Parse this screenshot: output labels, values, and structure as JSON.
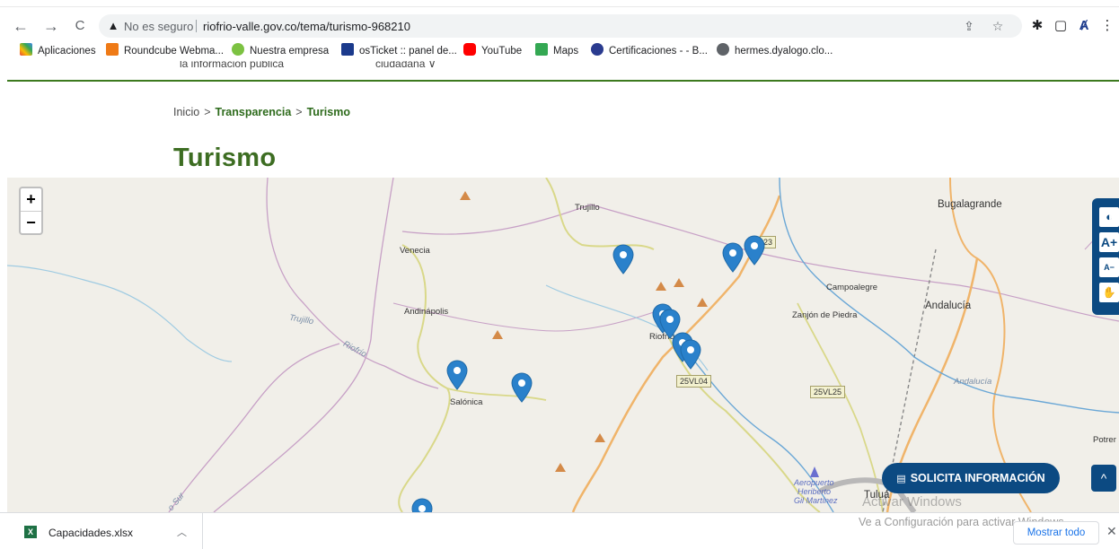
{
  "browser": {
    "back": "←",
    "forward": "→",
    "reload": "C",
    "security_label": "No es seguro",
    "url": "riofrio-valle.gov.co/tema/turismo-968210",
    "share_icon": "share-icon",
    "star_icon": "star-icon"
  },
  "bookmarks": [
    {
      "label": "Aplicaciones",
      "color": "#e8453c"
    },
    {
      "label": "Roundcube Webma...",
      "color": "#ef7a16"
    },
    {
      "label": "Nuestra empresa",
      "color": "#7cc242"
    },
    {
      "label": "osTicket :: panel de...",
      "color": "#1b3a8c"
    },
    {
      "label": "YouTube",
      "color": "#ff0000"
    },
    {
      "label": "Maps",
      "color": "#34a853"
    },
    {
      "label": "Certificaciones - - B...",
      "color": "#2a3b8f"
    },
    {
      "label": "hermes.dyalogo.clo...",
      "color": "#5f6368"
    }
  ],
  "page": {
    "cut_nav_left": "la información pública",
    "cut_nav_right": "ciudadana ∨",
    "breadcrumb": {
      "home": "Inicio",
      "sep": ">",
      "section": "Transparencia",
      "current": "Turismo"
    },
    "title": "Turismo"
  },
  "map": {
    "zoom_in": "+",
    "zoom_out": "−",
    "labels": {
      "trujillo_town": "Trujillo",
      "bugalagrande": "Bugalagrande",
      "venecia": "Venecia",
      "campoalegre": "Campoalegre",
      "andinapolis": "Andinápolis",
      "zanjon": "Zanjón de Piedra",
      "andalucia": "Andalucía",
      "riofrio_town": "Riofrío",
      "salonica": "Salónica",
      "andalucia_river": "Andalucía",
      "trujillo_river": "Trujillo",
      "riofrio_river": "Riofrío",
      "potrer": "Potrer",
      "tulua": "Tuluá",
      "aeropuerto": "Aeropuerto",
      "heriberto": "Heriberto",
      "gilmartinez": "Gil Martínez",
      "sur": "o Sur",
      "road_23": "23"
    },
    "roads": {
      "r1": "25VL04",
      "r2": "25VL25"
    }
  },
  "accessibility": {
    "contrast_icon": "contrast-icon",
    "font_increase": "A+",
    "font_decrease": "A−",
    "sign_icon": "sign-language-icon"
  },
  "actions": {
    "solicita": "SOLICITA INFORMACIÓN",
    "scroll_up": "^"
  },
  "windows_watermark": {
    "line1": "Activar Windows",
    "line2": "Ve a Configuración para activar Windows."
  },
  "downloads": {
    "file": "Capacidades.xlsx",
    "show_all": "Mostrar todo",
    "close": "✕"
  }
}
